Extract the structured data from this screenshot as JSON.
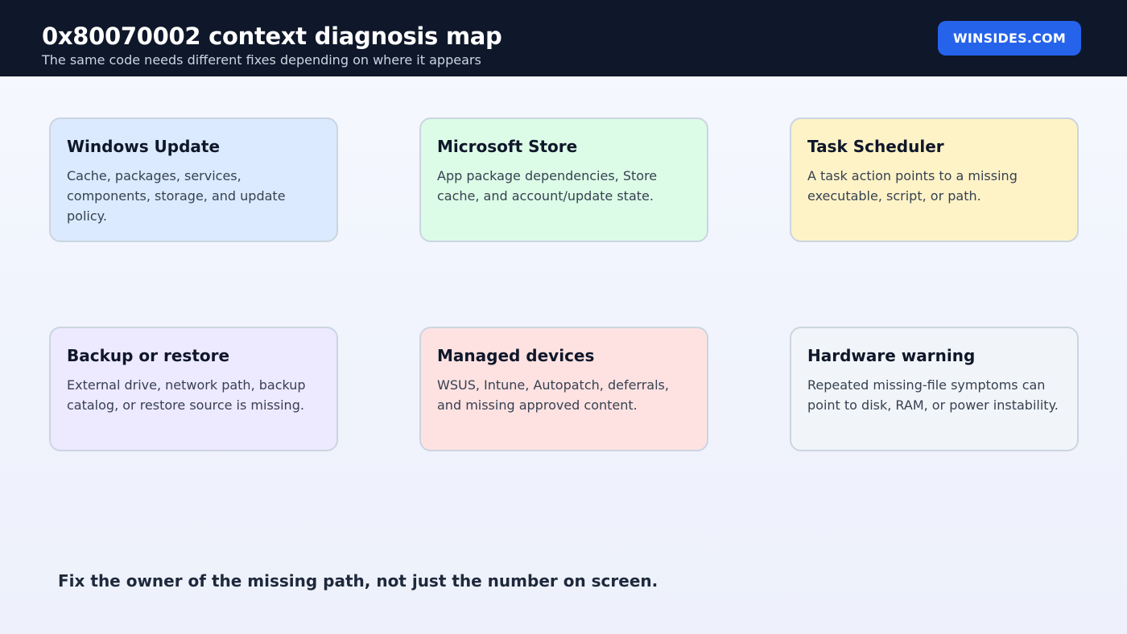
{
  "header": {
    "title": "0x80070002 context diagnosis map",
    "subtitle": "The same code needs different fixes depending on where it appears",
    "badge_label": "WINSIDES.COM",
    "badge_color": "#2563eb",
    "background_color": "#0f172a"
  },
  "cards": [
    {
      "title": "Windows Update",
      "text": "Cache, packages, services, components, storage, and update policy.",
      "color": "#dbeafe"
    },
    {
      "title": "Microsoft Store",
      "text": "App package dependencies, Store cache, and account/update state.",
      "color": "#dcfce7"
    },
    {
      "title": "Task Scheduler",
      "text": "A task action points to a missing executable, script, or path.",
      "color": "#fef3c7"
    },
    {
      "title": "Backup or restore",
      "text": "External drive, network path, backup catalog, or restore source is missing.",
      "color": "#ede9fe"
    },
    {
      "title": "Managed devices",
      "text": "WSUS, Intune, Autopatch, deferrals, and missing approved content.",
      "color": "#fee2e2"
    },
    {
      "title": "Hardware warning",
      "text": "Repeated missing-file symptoms can point to disk, RAM, or power instability.",
      "color": "#f1f5f9"
    }
  ],
  "footer": {
    "note": "Fix the owner of the missing path, not just the number on screen."
  }
}
